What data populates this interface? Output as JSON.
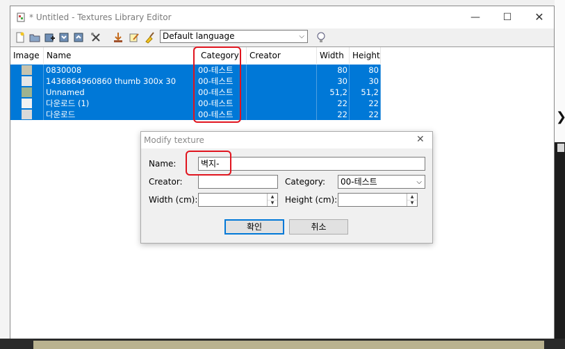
{
  "window": {
    "title": "* Untitled - Textures Library Editor",
    "minimize_glyph": "—",
    "maximize_glyph": "☐",
    "close_glyph": "✕"
  },
  "toolbar": {
    "icons": [
      "new-file-icon",
      "open-folder-icon",
      "add-texture-icon",
      "import-icon",
      "export-icon",
      "tools-icon",
      "download-icon",
      "edit-icon",
      "clean-icon"
    ],
    "language": "Default language",
    "hint_icon": "lightbulb-icon"
  },
  "table": {
    "columns": [
      "Image",
      "Name",
      "Category",
      "Creator",
      "Width",
      "Height"
    ],
    "rows": [
      {
        "name": "0830008",
        "category": "00-테스트",
        "creator": "",
        "width": "80",
        "height": "80",
        "swatch": "#c7c3ae"
      },
      {
        "name": "1436864960860 thumb 300x 30",
        "category": "00-테스트",
        "creator": "",
        "width": "30",
        "height": "30",
        "swatch": "#e6e6e6"
      },
      {
        "name": "Unnamed",
        "category": "00-테스트",
        "creator": "",
        "width": "51,2",
        "height": "51,2",
        "swatch": "#9fb38f"
      },
      {
        "name": "다운로드 (1)",
        "category": "00-테스트",
        "creator": "",
        "width": "22",
        "height": "22",
        "swatch": "#f2f2f2"
      },
      {
        "name": "다운로드",
        "category": "00-테스트",
        "creator": "",
        "width": "22",
        "height": "22",
        "swatch": "#d9d9d9"
      }
    ]
  },
  "dialog": {
    "title": "Modify texture",
    "close_glyph": "✕",
    "name_label": "Name:",
    "name_value": "벽지-",
    "creator_label": "Creator:",
    "creator_value": "",
    "category_label": "Category:",
    "category_value": "00-테스트",
    "width_label": "Width (cm):",
    "width_value": "",
    "height_label": "Height (cm):",
    "height_value": "",
    "ok_label": "확인",
    "cancel_label": "취소"
  },
  "colors": {
    "selection": "#0078d7",
    "highlight": "#e0141e"
  }
}
